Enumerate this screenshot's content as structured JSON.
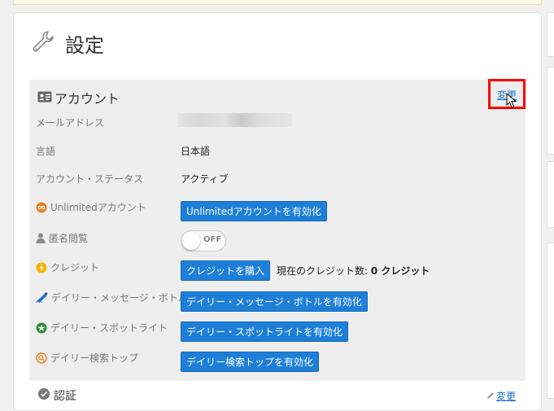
{
  "page": {
    "title": "設定"
  },
  "account": {
    "title": "アカウント",
    "edit_label": "変更",
    "rows": {
      "email": {
        "label": "メールアドレス"
      },
      "language": {
        "label": "言語",
        "value": "日本語"
      },
      "status": {
        "label": "アカウント・ステータス",
        "value": "アクティブ"
      },
      "unlimited": {
        "label": "Unlimitedアカウント",
        "button": "Unlimitedアカウントを有効化"
      },
      "anonymous": {
        "label": "匿名閲覧",
        "toggle": "OFF"
      },
      "credits": {
        "label": "クレジット",
        "button": "クレジットを購入",
        "status_prefix": "現在のクレジット数:",
        "status_value": "0 クレジット"
      },
      "bottle": {
        "label": "デイリー・メッセージ・ボトル",
        "button": "デイリー・メッセージ・ボトルを有効化"
      },
      "spotlight": {
        "label": "デイリー・スポットライト",
        "button": "デイリー・スポットライトを有効化"
      },
      "search_top": {
        "label": "デイリー検索トップ",
        "button": "デイリー検索トップを有効化"
      }
    }
  },
  "next_section": {
    "title": "認証",
    "edit_label": "変更"
  },
  "colors": {
    "primary_button": "#1e7fd8",
    "link": "#1a73c8",
    "highlight_box": "#ff0000"
  }
}
